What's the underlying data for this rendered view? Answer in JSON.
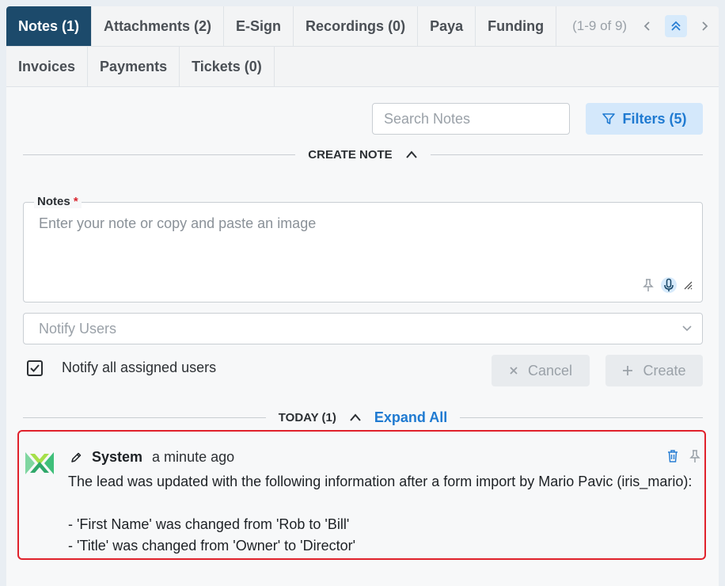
{
  "tabs_row1": [
    {
      "label": "Notes (1)",
      "active": true
    },
    {
      "label": "Attachments (2)",
      "active": false
    },
    {
      "label": "E-Sign",
      "active": false
    },
    {
      "label": "Recordings (0)",
      "active": false
    },
    {
      "label": "Paya",
      "active": false
    },
    {
      "label": "Funding",
      "active": false
    }
  ],
  "tabs_row2": [
    {
      "label": "Invoices"
    },
    {
      "label": "Payments"
    },
    {
      "label": "Tickets (0)"
    }
  ],
  "pager": {
    "count": "(1-9 of 9)"
  },
  "search": {
    "placeholder": "Search Notes"
  },
  "filters": {
    "label": "Filters (5)"
  },
  "create_section": {
    "label": "CREATE NOTE"
  },
  "notes_field": {
    "label": "Notes",
    "required_mark": "*",
    "placeholder": "Enter your note or copy and paste an image"
  },
  "notify_select": {
    "placeholder": "Notify Users"
  },
  "notify_all": {
    "label": "Notify all assigned users",
    "checked": true
  },
  "buttons": {
    "cancel": "Cancel",
    "create": "Create"
  },
  "today_section": {
    "label": "TODAY (1)",
    "expand_all": "Expand All"
  },
  "note": {
    "author": "System",
    "time": "a minute ago",
    "lines": [
      "The lead was updated with the following information after a form import by Mario Pavic (iris_mario):",
      "",
      "- 'First Name' was changed from 'Rob to 'Bill'",
      "- 'Title' was changed from 'Owner' to 'Director'"
    ]
  },
  "colors": {
    "active_tab": "#1c4a6b",
    "accent": "#1f7ad1",
    "highlight_border": "#e0212b"
  }
}
